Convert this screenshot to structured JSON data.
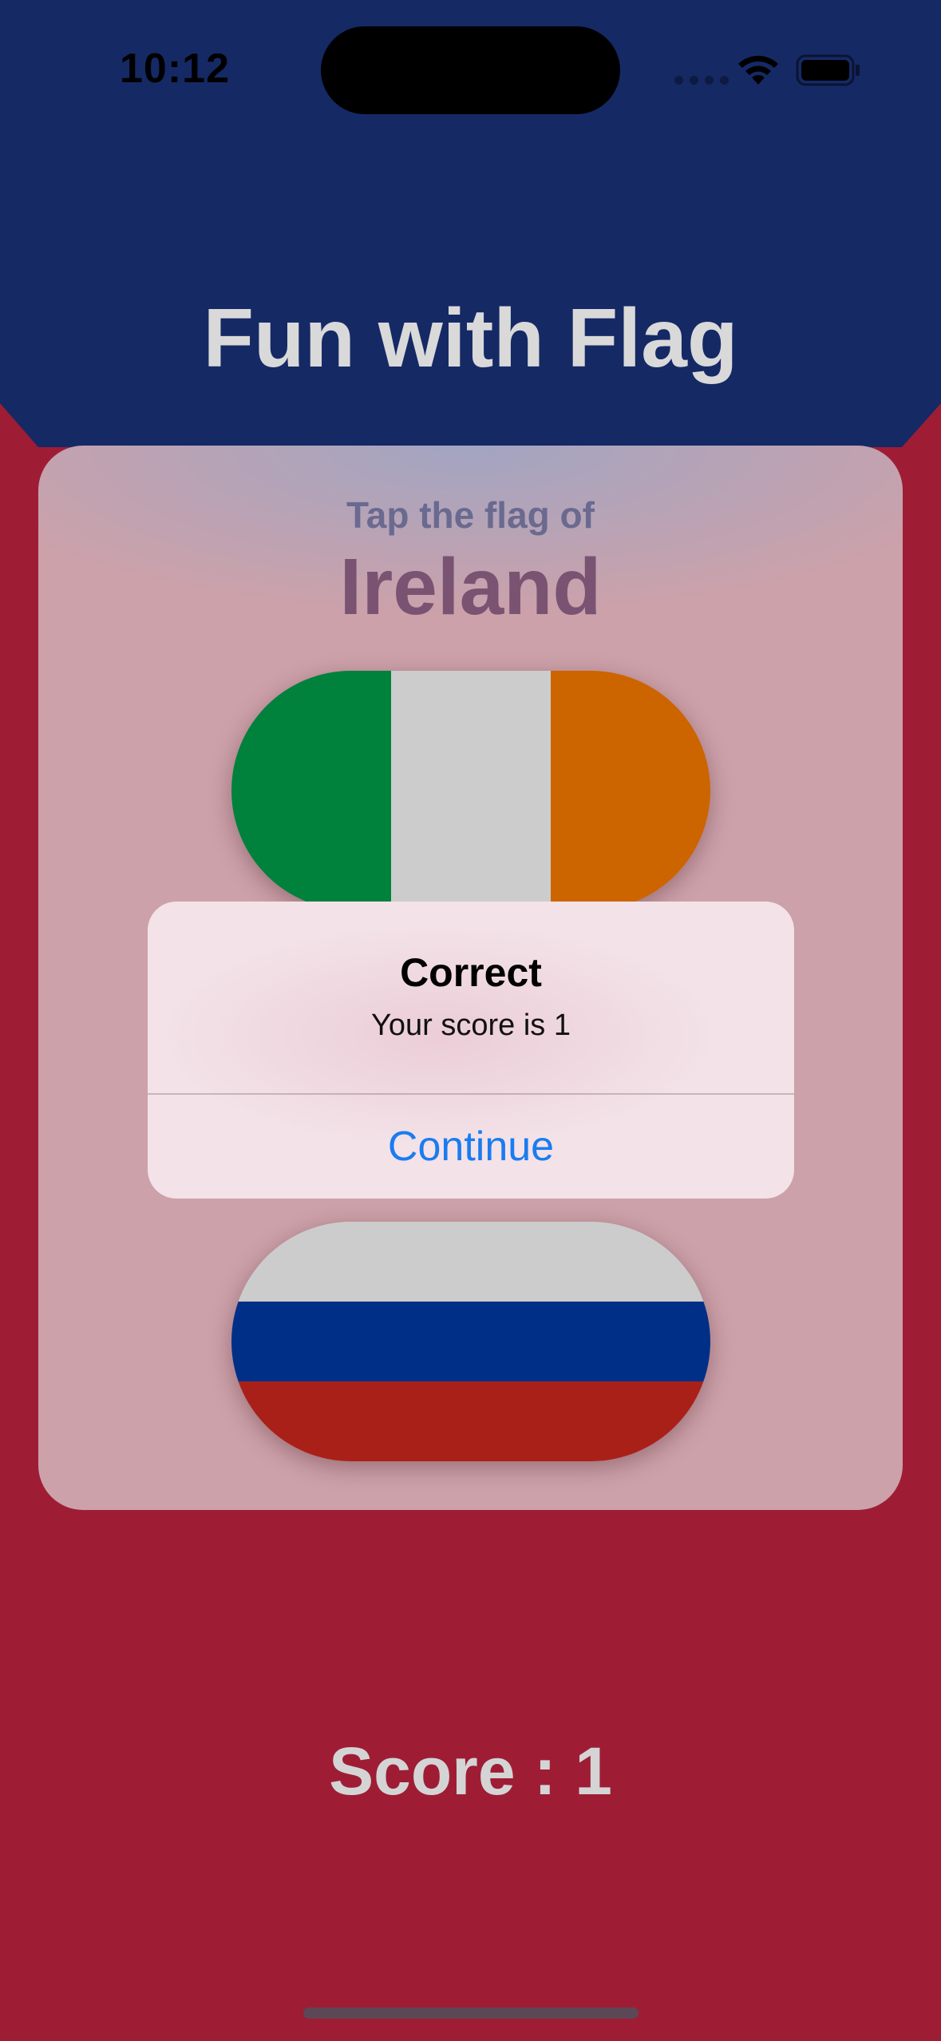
{
  "status_bar": {
    "time": "10:12"
  },
  "app": {
    "title": "Fun with Flag"
  },
  "question": {
    "prompt": "Tap the flag of",
    "country": "Ireland"
  },
  "flags": [
    {
      "country": "Ireland",
      "colors": [
        "#00813c",
        "#cccccc",
        "#cc6400"
      ],
      "orientation": "vertical"
    },
    {
      "country": "Russia",
      "colors": [
        "#cccccc",
        "#002f87",
        "#a92019"
      ],
      "orientation": "horizontal"
    }
  ],
  "alert": {
    "title": "Correct",
    "message": "Your score is 1",
    "button_label": "Continue"
  },
  "score": {
    "label": "Score : 1"
  },
  "colors": {
    "top_background": "#152965",
    "bottom_background": "#9e1d35",
    "accent_blue": "#1a7cf0"
  }
}
